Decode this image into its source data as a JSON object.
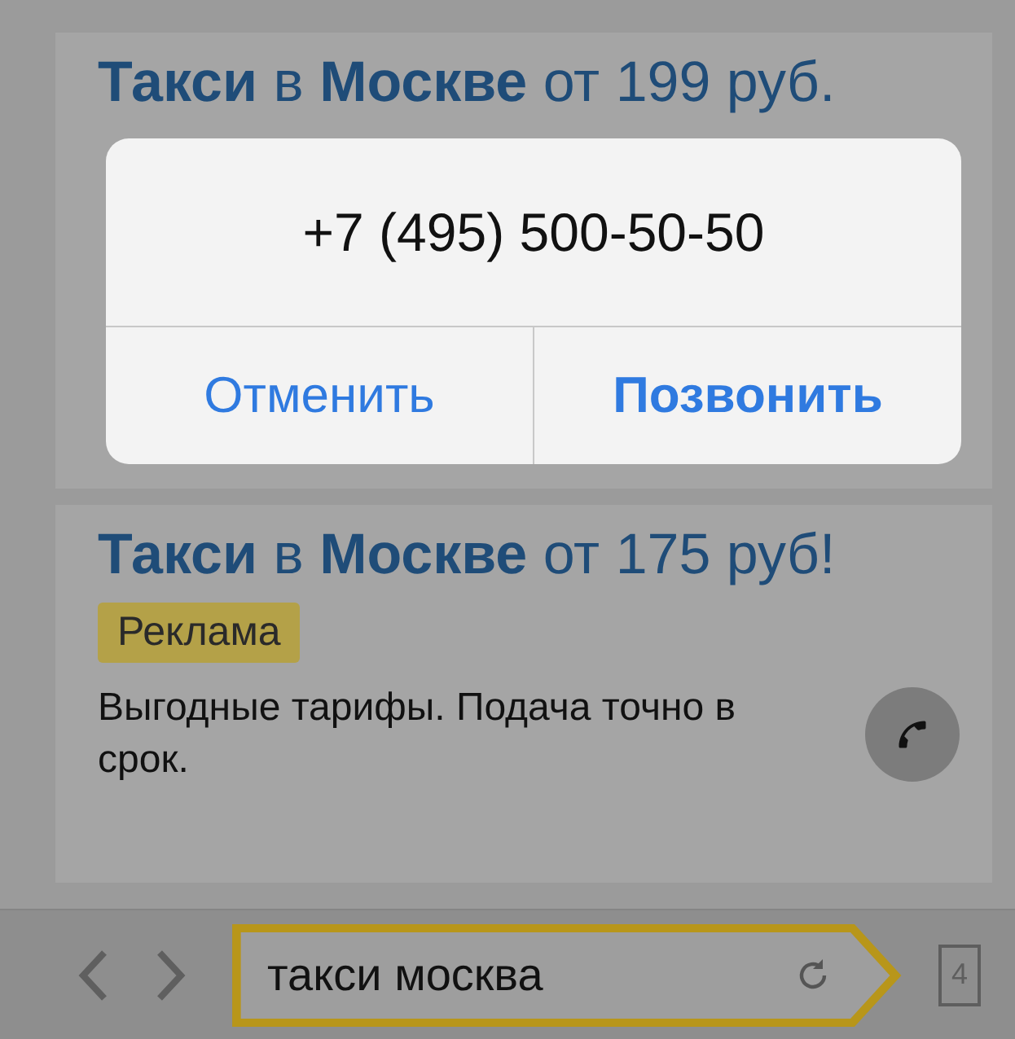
{
  "results": [
    {
      "title": "**Такси** в **Москве** от 199 руб.",
      "call_button": false
    },
    {
      "title": "**Такси** в **Москве** от 175 руб!",
      "badge": "Реклама",
      "text": "Выгодные тарифы. Подача точно в срок.",
      "call_button": true
    }
  ],
  "dialog": {
    "message": "+7 (495) 500-50-50",
    "buttons": [
      {
        "label": "Отменить",
        "kind": "cancel"
      },
      {
        "label": "Позвонить",
        "kind": "confirm"
      }
    ]
  },
  "toolbar": {
    "query": "такси москва",
    "tab_count": "4"
  }
}
